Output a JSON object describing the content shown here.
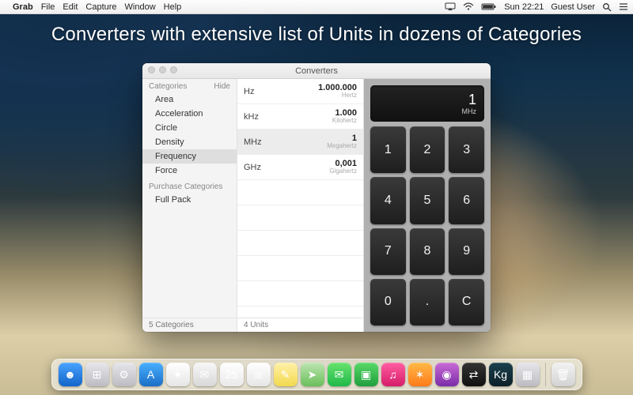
{
  "menubar": {
    "app_name": "Grab",
    "items": [
      "File",
      "Edit",
      "Capture",
      "Window",
      "Help"
    ],
    "clock": "Sun 22:21",
    "user": "Guest User"
  },
  "tagline": "Converters with extensive list of Units in dozens of Categories",
  "window": {
    "title": "Converters",
    "sidebar": {
      "heading": "Categories",
      "hide_label": "Hide",
      "categories": [
        "Area",
        "Acceleration",
        "Circle",
        "Density",
        "Frequency",
        "Force"
      ],
      "selected_index": 4,
      "purchase_heading": "Purchase Categories",
      "purchase_items": [
        "Full Pack"
      ],
      "footer": "5 Categories"
    },
    "units": {
      "rows": [
        {
          "abbr": "Hz",
          "value": "1.000.000",
          "name": "Hertz"
        },
        {
          "abbr": "kHz",
          "value": "1.000",
          "name": "Kilohertz"
        },
        {
          "abbr": "MHz",
          "value": "1",
          "name": "Megahertz"
        },
        {
          "abbr": "GHz",
          "value": "0,001",
          "name": "Gigahertz"
        }
      ],
      "selected_index": 2,
      "footer": "4 Units"
    },
    "calculator": {
      "display_value": "1",
      "display_unit": "MHz",
      "keys": [
        "1",
        "2",
        "3",
        "4",
        "5",
        "6",
        "7",
        "8",
        "9",
        "0",
        ".",
        "C"
      ]
    }
  },
  "dock": {
    "items": [
      {
        "name": "finder",
        "glyph": "☻",
        "cls": "g-blue"
      },
      {
        "name": "launchpad",
        "glyph": "⊞",
        "cls": "g-grey"
      },
      {
        "name": "settings",
        "glyph": "⚙",
        "cls": "g-grey"
      },
      {
        "name": "appstore",
        "glyph": "A",
        "cls": "g-comp"
      },
      {
        "name": "safari",
        "glyph": "✦",
        "cls": "g-white"
      },
      {
        "name": "mail",
        "glyph": "✉",
        "cls": "g-mail"
      },
      {
        "name": "calendar",
        "glyph": "25",
        "cls": "g-cal"
      },
      {
        "name": "reminders",
        "glyph": "≣",
        "cls": "g-white"
      },
      {
        "name": "notes",
        "glyph": "✎",
        "cls": "g-note"
      },
      {
        "name": "maps",
        "glyph": "➤",
        "cls": "g-map"
      },
      {
        "name": "messages",
        "glyph": "✉",
        "cls": "g-msg"
      },
      {
        "name": "facetime",
        "glyph": "▣",
        "cls": "g-vid"
      },
      {
        "name": "itunes",
        "glyph": "♫",
        "cls": "g-pink"
      },
      {
        "name": "ibooks",
        "glyph": "✶",
        "cls": "g-orng"
      },
      {
        "name": "podcasts",
        "glyph": "◉",
        "cls": "g-purp"
      },
      {
        "name": "converters",
        "glyph": "⇄",
        "cls": "g-dark"
      },
      {
        "name": "terminal",
        "glyph": "Kg",
        "cls": "g-dark2"
      },
      {
        "name": "activity",
        "glyph": "▦",
        "cls": "g-grey"
      }
    ],
    "trash_glyph": "🗑"
  }
}
